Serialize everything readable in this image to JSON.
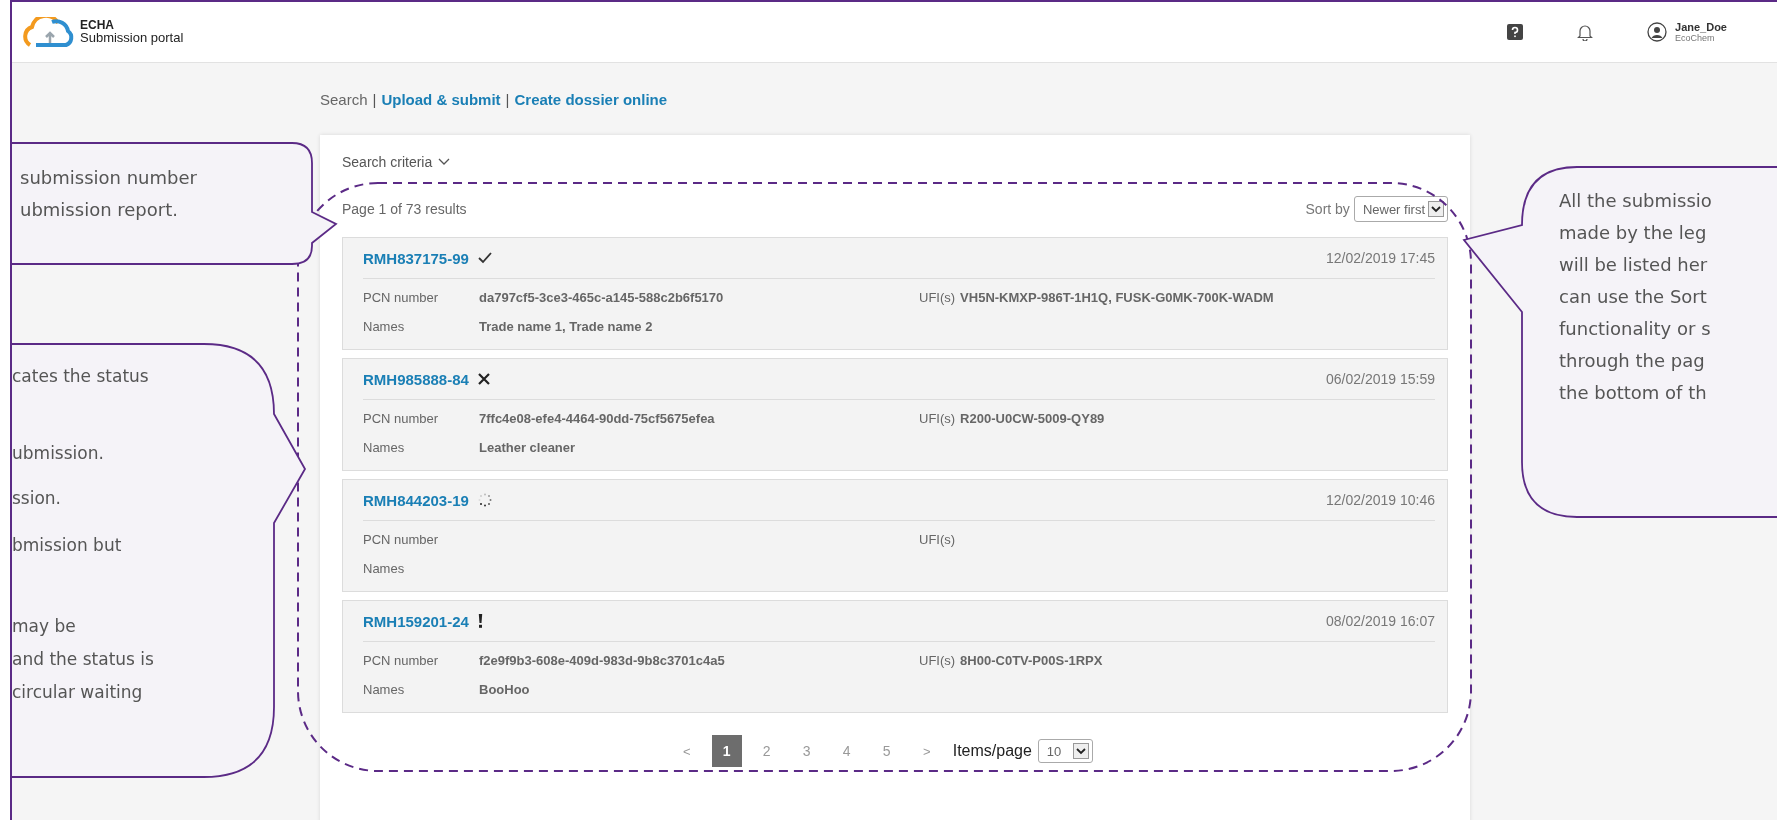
{
  "header": {
    "logo": {
      "title": "ECHA",
      "subtitle": "Submission portal"
    },
    "user": {
      "name": "Jane_Doe",
      "company": "EcoChem"
    }
  },
  "breadcrumb": {
    "separator": "|",
    "items": [
      {
        "label": "Search",
        "selected": true
      },
      {
        "label": "Upload & submit",
        "selected": false
      },
      {
        "label": "Create dossier online",
        "selected": false
      }
    ]
  },
  "search_criteria": "Search criteria",
  "results_summary": "Page 1 of 73 results",
  "sort": {
    "label": "Sort by",
    "value": "Newer first"
  },
  "submissions": [
    {
      "id": "RMH837175-99",
      "kind": "success",
      "date": "12/02/2019 17:45",
      "pcn_label": "PCN number",
      "pcn": "da797cf5-3ce3-465c-a145-588c2b6f5170",
      "ufi_label": "UFI(s)",
      "ufi": "VH5N-KMXP-986T-1H1Q, FUSK-G0MK-700K-WADM",
      "names_label": "Names",
      "names": "Trade name 1, Trade name 2"
    },
    {
      "id": "RMH985888-84",
      "kind": "failed",
      "date": "06/02/2019 15:59",
      "pcn_label": "PCN number",
      "pcn": "7ffc4e08-efe4-4464-90dd-75cf5675efea",
      "ufi_label": "UFI(s)",
      "ufi": "R200-U0CW-5009-QY89",
      "names_label": "Names",
      "names": "Leather cleaner"
    },
    {
      "id": "RMH844203-19",
      "kind": "pending",
      "date": "12/02/2019 10:46",
      "pcn_label": "PCN number",
      "ufi_label": "UFI(s)",
      "names_label": "Names"
    },
    {
      "id": "RMH159201-24",
      "kind": "warning",
      "date": "08/02/2019 16:07",
      "pcn_label": "PCN number",
      "pcn": "f2e9f9b3-608e-409d-983d-9b8c3701c4a5",
      "ufi_label": "UFI(s)",
      "ufi": "8H00-C0TV-P00S-1RPX",
      "names_label": "Names",
      "names": "BooHoo"
    }
  ],
  "pagination": {
    "prev": "<",
    "pages": [
      {
        "label": "1",
        "selected": true
      },
      {
        "label": "2",
        "selected": false
      },
      {
        "label": "3",
        "selected": false
      },
      {
        "label": "4",
        "selected": false
      },
      {
        "label": "5",
        "selected": false
      }
    ],
    "next": ">",
    "items_label": "Items/page",
    "items_value": "10"
  },
  "callouts": [
    {
      "paragraphs": [
        [
          "submission  number",
          "ubmission report."
        ]
      ]
    },
    {
      "paragraphs": [
        [
          "cates the status"
        ],
        [
          "ubmission."
        ],
        [
          "ssion."
        ],
        [
          "bmission but"
        ],
        [
          "may be",
          "and the status is",
          "circular waiting"
        ]
      ]
    },
    {
      "paragraphs": [
        [
          "All the submissio",
          "made by the leg",
          "will be listed her",
          "can use the Sort",
          "functionality or s",
          "through the pag",
          "the bottom of th"
        ]
      ]
    }
  ]
}
